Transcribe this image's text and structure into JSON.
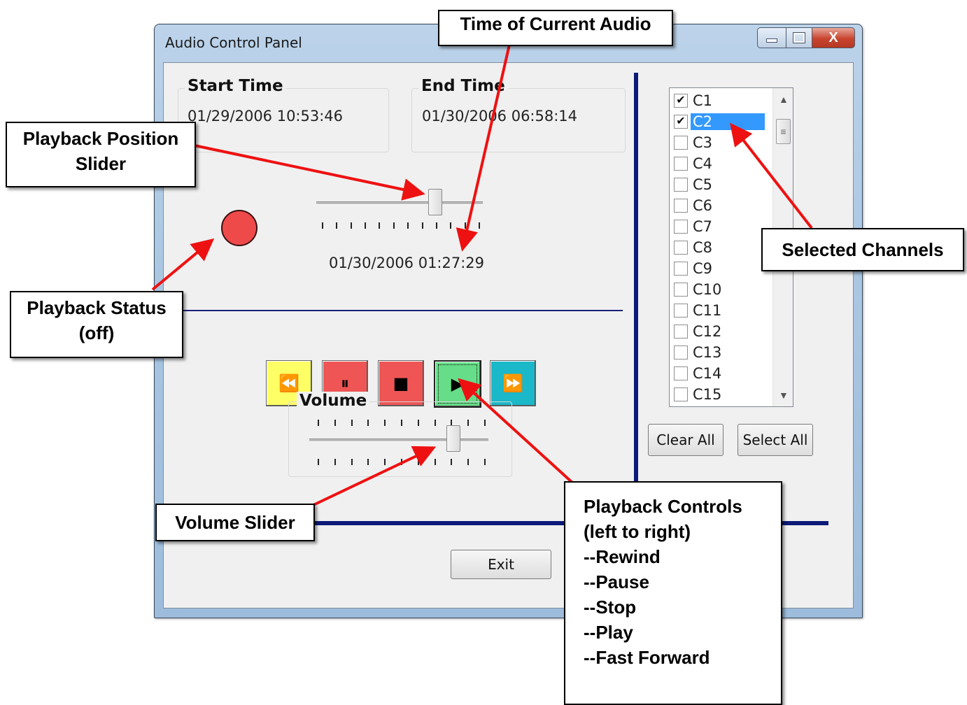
{
  "window": {
    "title": "Audio Control Panel",
    "minimize_glyph": "minimize-icon",
    "maximize_glyph": "maximize-icon",
    "close_glyph": "X"
  },
  "start_time": {
    "label": "Start Time",
    "value": "01/29/2006 10:53:46"
  },
  "end_time": {
    "label": "End Time",
    "value": "01/30/2006 06:58:14"
  },
  "playback": {
    "current_time": "01/30/2006 01:27:29",
    "position_fraction": 0.71,
    "status": "off",
    "status_color": "#ef4a4a"
  },
  "controls": [
    {
      "name": "rewind-button",
      "icon": "rewind-icon",
      "glyph": "⏪",
      "color": "#ffff66"
    },
    {
      "name": "pause-button",
      "icon": "pause-icon",
      "glyph": "⏸",
      "color": "#ef5555"
    },
    {
      "name": "stop-button",
      "icon": "stop-icon",
      "glyph": "■",
      "color": "#ef5555"
    },
    {
      "name": "play-button",
      "icon": "play-icon",
      "glyph": "▶",
      "color": "#66dd88"
    },
    {
      "name": "fast-forward-button",
      "icon": "fast-forward-icon",
      "glyph": "⏩",
      "color": "#1ab8c8"
    }
  ],
  "volume": {
    "label": "Volume",
    "level_fraction": 0.8
  },
  "channels": {
    "items": [
      {
        "label": "C1",
        "checked": true,
        "selected": false
      },
      {
        "label": "C2",
        "checked": true,
        "selected": true
      },
      {
        "label": "C3",
        "checked": false,
        "selected": false
      },
      {
        "label": "C4",
        "checked": false,
        "selected": false
      },
      {
        "label": "C5",
        "checked": false,
        "selected": false
      },
      {
        "label": "C6",
        "checked": false,
        "selected": false
      },
      {
        "label": "C7",
        "checked": false,
        "selected": false
      },
      {
        "label": "C8",
        "checked": false,
        "selected": false
      },
      {
        "label": "C9",
        "checked": false,
        "selected": false
      },
      {
        "label": "C10",
        "checked": false,
        "selected": false
      },
      {
        "label": "C11",
        "checked": false,
        "selected": false
      },
      {
        "label": "C12",
        "checked": false,
        "selected": false
      },
      {
        "label": "C13",
        "checked": false,
        "selected": false
      },
      {
        "label": "C14",
        "checked": false,
        "selected": false
      },
      {
        "label": "C15",
        "checked": false,
        "selected": false
      }
    ],
    "clear_all_label": "Clear All",
    "select_all_label": "Select All"
  },
  "exit_label": "Exit",
  "annotations": {
    "time_of_current_audio": "Time of Current Audio",
    "playback_position_slider": [
      "Playback Position",
      "Slider"
    ],
    "playback_status": [
      "Playback Status",
      "(off)"
    ],
    "selected_channels": "Selected Channels",
    "volume_slider": "Volume Slider",
    "playback_controls": [
      "Playback Controls",
      "(left to right)",
      "--Rewind",
      "--Pause",
      "--Stop",
      "--Play",
      "--Fast Forward"
    ]
  },
  "annotation_arrow_color": "#ee1111"
}
